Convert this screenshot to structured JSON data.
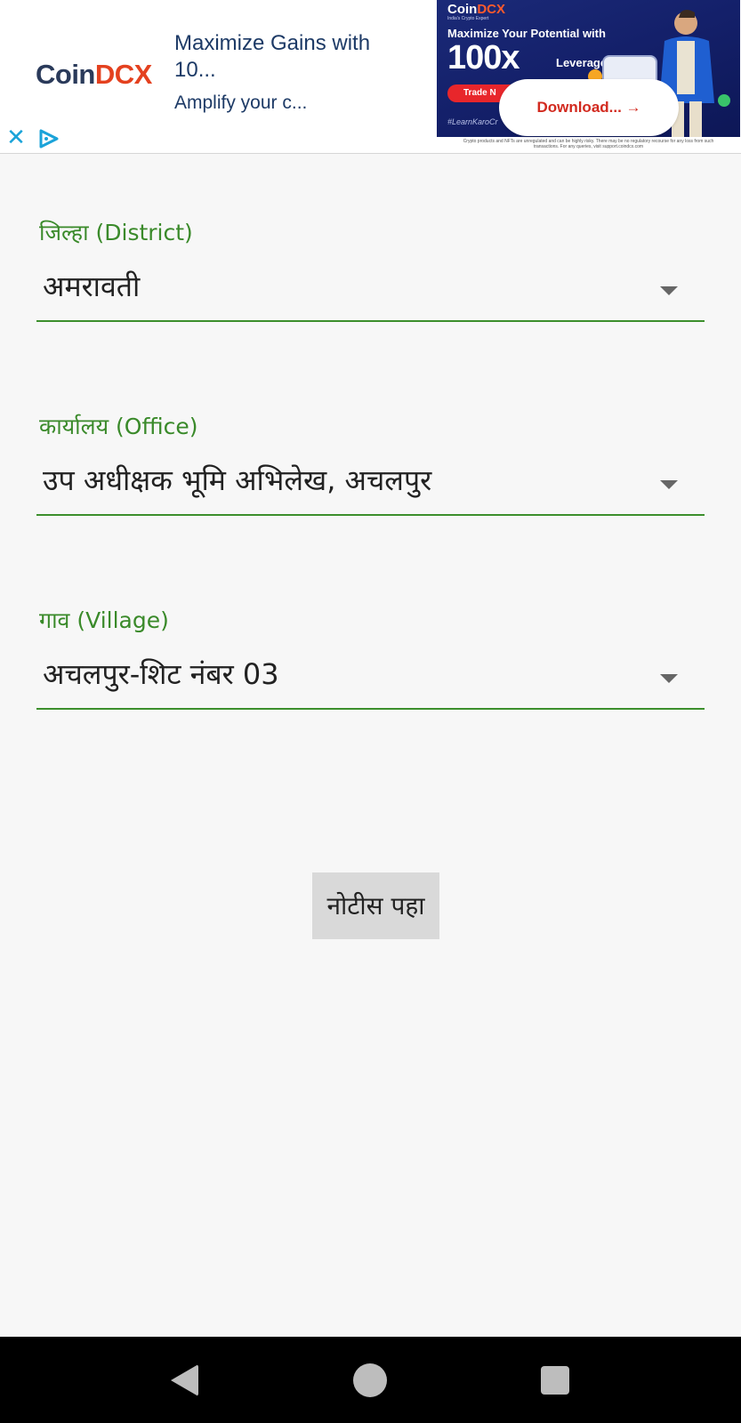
{
  "ad": {
    "brand_prefix": "Coin",
    "brand_suffix": "DCX",
    "headline": "Maximize Gains with 10...",
    "body": "Amplify your c...",
    "close_glyph": "✕",
    "image": {
      "brand_prefix": "Coin",
      "brand_suffix": "DCX",
      "tagline": "India's Crypto Expert",
      "headline": "Maximize Your Potential with",
      "big_text": "100x",
      "leverage_text": "Leverage",
      "trade_label": "Trade N",
      "hashtag": "#LearnKaroCr",
      "disclaimer": "Crypto products and NFTs are unregulated and can be highly risky. There may be no regulatory recourse for any loss from such transactions. For any queries, visit support.coindcx.com"
    },
    "cta_label": "Download... →",
    "colors": {
      "brand_dark": "#2a3a5a",
      "brand_accent": "#e4411f",
      "cta_text": "#d22a1f"
    }
  },
  "form": {
    "district": {
      "label": "जिल्हा (District)",
      "value": "अमरावती"
    },
    "office": {
      "label": "कार्यालय (Office)",
      "value": "उप अधीक्षक भूमि  अभिलेख, अचलपुर"
    },
    "village": {
      "label": "गाव (Village)",
      "value": "अचलपुर-शिट नंबर 03"
    },
    "submit_label": "नोटीस पहा",
    "colors": {
      "label": "#3a8a2a",
      "underline": "#3c8f2c"
    }
  },
  "nav": {
    "icons": [
      "back-icon",
      "home-icon",
      "recents-icon"
    ]
  }
}
